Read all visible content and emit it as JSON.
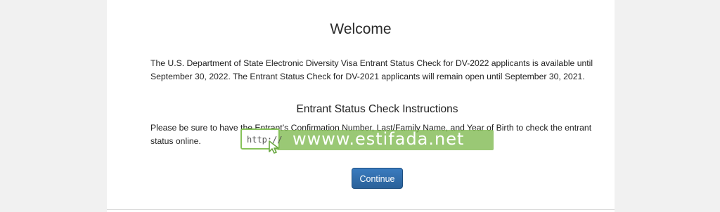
{
  "main": {
    "title": "Welcome",
    "intro": "The U.S. Department of State Electronic Diversity Visa Entrant Status Check for DV-2022 applicants is available until September 30, 2022. The Entrant Status Check for DV-2021 applicants will remain open until September 30, 2021.",
    "instructions_heading": "Entrant Status Check Instructions",
    "instructions_text": "Please be sure to have the Entrant’s Confirmation Number, Last/Family Name, and Year of Birth to check the entrant status online.",
    "continue_label": "Continue"
  },
  "watermark": {
    "url_prefix": "http://",
    "site": "wwww.estifada.net",
    "color": "#7db94e"
  },
  "icons": {
    "cursor": "cursor-arrow-icon"
  }
}
